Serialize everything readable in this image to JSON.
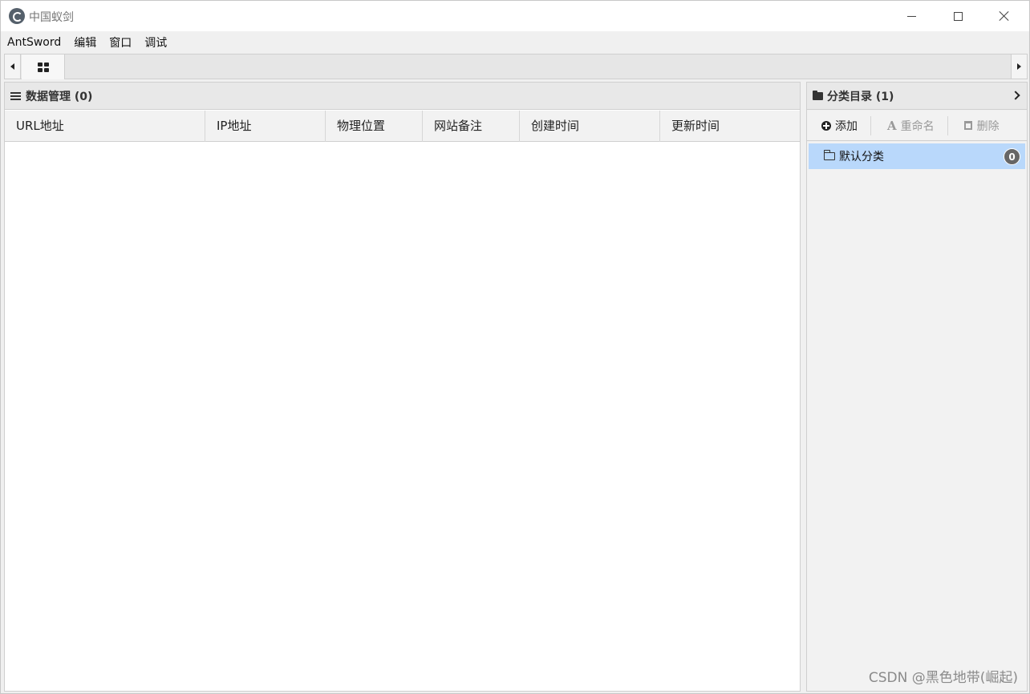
{
  "window": {
    "title": "中国蚁剑"
  },
  "menu": {
    "items": [
      "AntSword",
      "编辑",
      "窗口",
      "调试"
    ]
  },
  "data_panel": {
    "title": "数据管理 (0)",
    "columns": [
      "URL地址",
      "IP地址",
      "物理位置",
      "网站备注",
      "创建时间",
      "更新时间"
    ],
    "rows": []
  },
  "category_panel": {
    "title": "分类目录 (1)",
    "toolbar": {
      "add_label": "添加",
      "rename_label": "重命名",
      "delete_label": "删除"
    },
    "items": [
      {
        "label": "默认分类",
        "count": "0",
        "selected": true
      }
    ]
  },
  "watermark": "CSDN @黑色地带(崛起)",
  "colors": {
    "selected_row": "#b9d8fb",
    "badge": "#666666"
  }
}
